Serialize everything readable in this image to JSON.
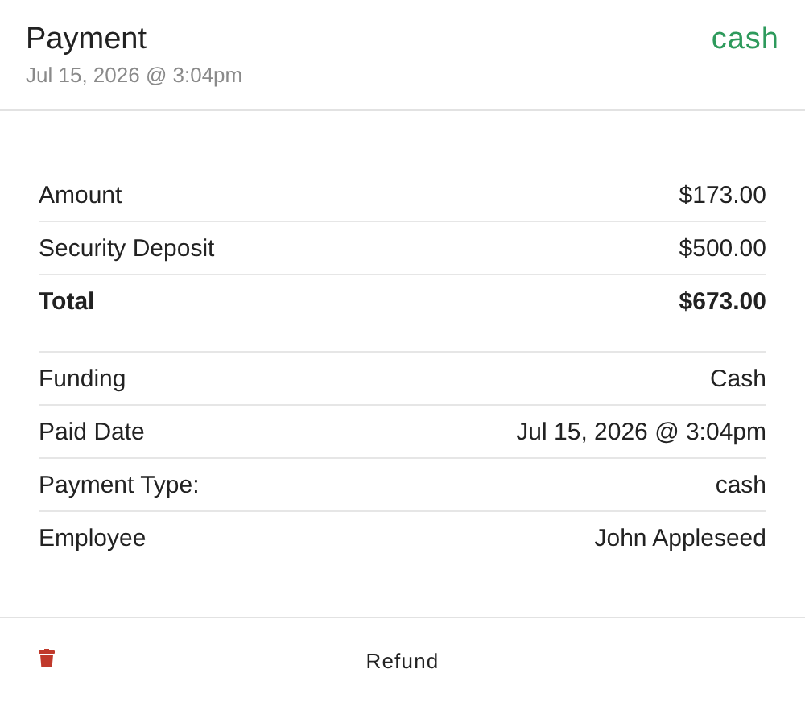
{
  "header": {
    "title": "Payment",
    "status": "cash",
    "date": "Jul 15, 2026 @ 3:04pm"
  },
  "sections": [
    {
      "rows": [
        {
          "label": "Amount",
          "value": "$173.00",
          "kind": "normal"
        },
        {
          "label": "Security Deposit",
          "value": "$500.00",
          "kind": "normal"
        },
        {
          "label": "Total",
          "value": "$673.00",
          "kind": "total"
        }
      ]
    },
    {
      "rows": [
        {
          "label": "Funding",
          "value": "Cash",
          "kind": "normal"
        },
        {
          "label": "Paid Date",
          "value": "Jul 15, 2026 @ 3:04pm",
          "kind": "normal"
        },
        {
          "label": "Payment Type:",
          "value": "cash",
          "kind": "normal"
        },
        {
          "label": "Employee",
          "value": "John Appleseed",
          "kind": "normal"
        }
      ]
    }
  ],
  "footer": {
    "action": "Refund"
  }
}
